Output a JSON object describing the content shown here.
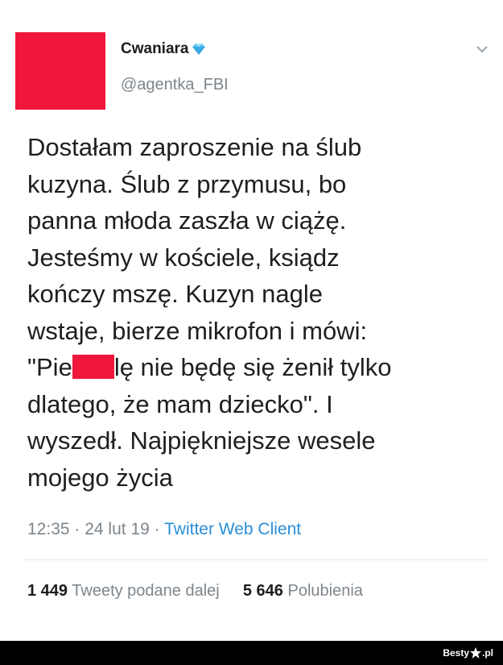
{
  "user": {
    "display_name": "Cwaniara",
    "handle": "@agentka_FBI"
  },
  "tweet": {
    "text_before_redaction": "Dostałam zaproszenie na ślub\nkuzyna. Ślub z przymusu, bo\npanna młoda zaszła w ciążę.\nJesteśmy w kościele, ksiądz\nkończy mszę. Kuzyn nagle\nwstaje, bierze mikrofon i mówi:\n\"Pie",
    "text_after_redaction": "lę nie będę się żenił tylko\ndlatego, że mam dziecko\". I\nwyszedł. Najpiękniejsze wesele\nmojego życia"
  },
  "meta": {
    "time": "12:35",
    "separator": " · ",
    "date": "24 lut 19",
    "client": "Twitter Web Client"
  },
  "stats": {
    "retweets_count": "1 449",
    "retweets_label": "Tweety podane dalej",
    "likes_count": "5 646",
    "likes_label": "Polubienia"
  },
  "footer": {
    "watermark": "Besty",
    "watermark_suffix": ".pl"
  },
  "colors": {
    "avatar": "#f0163c",
    "redaction": "#f0163c",
    "link": "#2a8fd8",
    "verified": "#5bc8f5"
  },
  "icons": {
    "verified": "diamond-verified-icon",
    "menu": "chevron-down-icon",
    "logo": "star-icon"
  }
}
